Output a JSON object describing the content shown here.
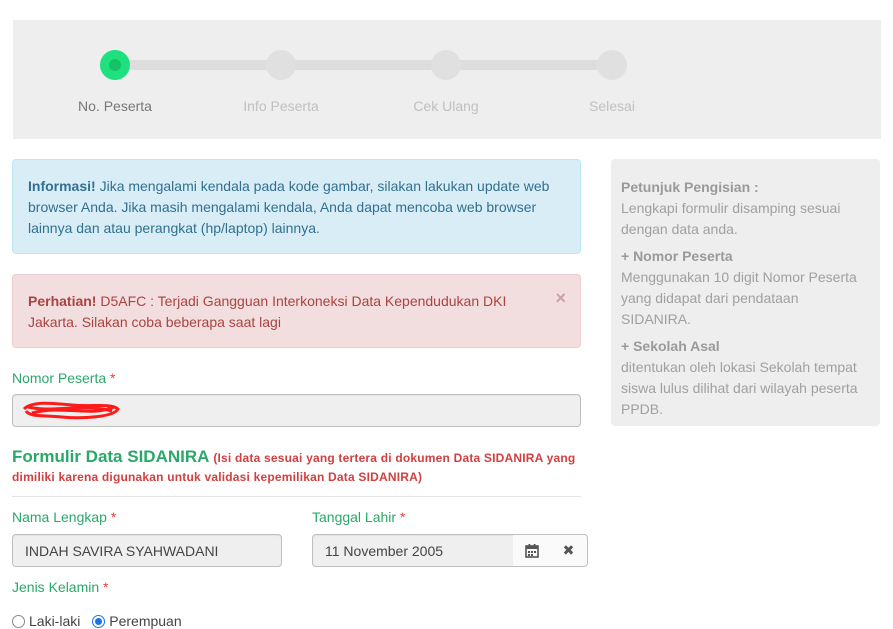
{
  "stepper": {
    "steps": [
      {
        "label": "No. Peserta",
        "active": true
      },
      {
        "label": "Info Peserta",
        "active": false
      },
      {
        "label": "Cek Ulang",
        "active": false
      },
      {
        "label": "Selesai",
        "active": false
      }
    ]
  },
  "alerts": {
    "info": {
      "title": "Informasi!",
      "text": " Jika mengalami kendala pada kode gambar, silakan lakukan update web browser Anda. Jika masih mengalami kendala, Anda dapat mencoba web browser lainnya dan atau perangkat (hp/laptop) lainnya."
    },
    "danger": {
      "title": "Perhatian!",
      "text": " D5AFC : Terjadi Gangguan Interkoneksi Data Kependudukan DKI Jakarta. Silakan coba beberapa saat lagi",
      "close": "×"
    }
  },
  "form": {
    "nomor_label": "Nomor Peserta",
    "required_mark": "*",
    "nomor_value": "",
    "section_title": "Formulir Data SIDANIRA",
    "section_note": "(Isi data sesuai yang tertera di dokumen Data SIDANIRA yang dimiliki karena digunakan untuk validasi kepemilikan Data SIDANIRA)",
    "nama_label": "Nama Lengkap",
    "nama_value": "INDAH SAVIRA SYAHWADANI",
    "tanggal_label": "Tanggal Lahir",
    "tanggal_value": "11 November 2005",
    "calendar_icon": "calendar-icon",
    "clear_icon": "close-icon",
    "clear_glyph": "✖",
    "jk_label": "Jenis Kelamin",
    "jk_options": [
      "Laki-laki",
      "Perempuan"
    ],
    "jk_selected": "Perempuan"
  },
  "help": {
    "title": "Petunjuk Pengisian :",
    "intro": "Lengkapi formulir disamping sesuai dengan data anda.",
    "items": [
      {
        "heading": "+ Nomor Peserta",
        "text": "Menggunakan 10 digit Nomor Peserta yang didapat dari pendataan SIDANIRA."
      },
      {
        "heading": "+ Sekolah Asal",
        "text": "ditentukan oleh lokasi Sekolah tempat siswa lulus dilihat dari wilayah peserta PPDB."
      }
    ]
  },
  "colors": {
    "accent": "#2aa86a",
    "active_step": "#1ee07f",
    "required": "#e04141"
  }
}
